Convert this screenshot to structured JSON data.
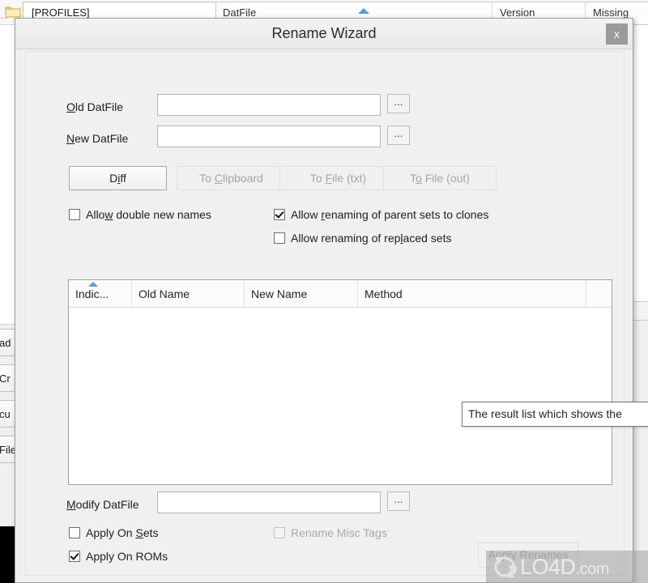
{
  "background": {
    "path_value": "[PROFILES]",
    "folder_icon": "folder-icon",
    "ellipsis": "...",
    "grid_columns": [
      {
        "label": "DatFile",
        "sorted": true
      },
      {
        "label": "Version",
        "sorted": false
      },
      {
        "label": "Missing",
        "sorted": false
      }
    ],
    "left_buttons": [
      {
        "label": "ad"
      },
      {
        "label": "Cr"
      },
      {
        "label": "cu"
      },
      {
        "label": "File"
      }
    ]
  },
  "dialog": {
    "title": "Rename Wizard",
    "close_label": "x",
    "fields": [
      {
        "label_pre": "",
        "label_accel": "O",
        "label_post": "ld DatFile",
        "value": "",
        "placeholder": "",
        "browse_label": "..."
      },
      {
        "label_pre": "",
        "label_accel": "N",
        "label_post": "ew DatFile",
        "value": "",
        "placeholder": "",
        "browse_label": "..."
      }
    ],
    "action_buttons": [
      {
        "pre": "D",
        "accel": "i",
        "post": "ff",
        "enabled": true
      },
      {
        "pre": "To ",
        "accel": "C",
        "post": "lipboard",
        "enabled": false
      },
      {
        "pre": "To ",
        "accel": "F",
        "post": "ile (txt)",
        "enabled": false
      },
      {
        "pre": "T",
        "accel": "o",
        "post": " File (out)",
        "enabled": false
      }
    ],
    "options": [
      {
        "pre": "Allo",
        "accel": "w",
        "post": " double new names",
        "checked": false,
        "enabled": true
      },
      {
        "pre": "Allow ",
        "accel": "r",
        "post": "enaming of parent sets to clones",
        "checked": true,
        "enabled": true
      },
      {
        "pre": "Allow renaming of rep",
        "accel": "l",
        "post": "aced sets",
        "checked": false,
        "enabled": true
      }
    ],
    "list": {
      "columns": [
        {
          "label": "Indic...",
          "sorted": true
        },
        {
          "label": "Old Name",
          "sorted": false
        },
        {
          "label": "New Name",
          "sorted": false
        },
        {
          "label": "Method",
          "sorted": false
        }
      ],
      "rows": []
    },
    "tooltip": "The result list which shows the",
    "modify": {
      "label_pre": "",
      "label_accel": "M",
      "label_post": "odify DatFile",
      "value": "",
      "placeholder": "",
      "browse_label": "..."
    },
    "bottom_options": [
      {
        "pre": "Apply On ",
        "accel": "S",
        "post": "ets",
        "checked": false,
        "enabled": true
      },
      {
        "pre": "Apply On ROMs",
        "accel": "",
        "post": "",
        "checked": true,
        "enabled": true
      },
      {
        "pre": "Rename Misc Ta",
        "accel": "g",
        "post": "s",
        "checked": false,
        "enabled": false
      }
    ],
    "apply_button": {
      "pre": "Apply",
      "accel": "y",
      "post": " Renames",
      "enabled": false
    }
  },
  "watermark": {
    "name": "LO4D",
    "suffix": ".com"
  },
  "colors": {
    "dialog_bg": "#f0f0f0",
    "accent_sort": "#5b9bd5",
    "title_text": "#2a2a36",
    "disabled_text": "#a6a6a6"
  }
}
